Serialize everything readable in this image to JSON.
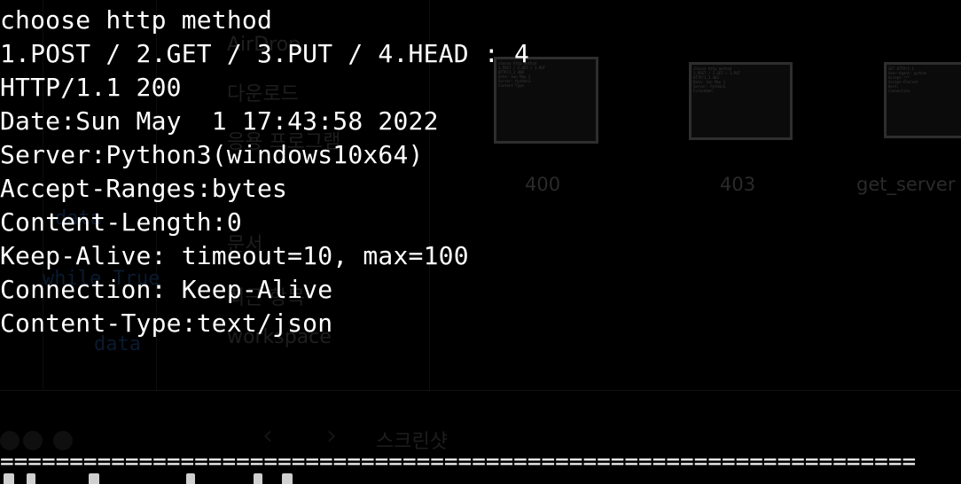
{
  "terminal": {
    "lines": [
      "choose http method",
      "1.POST / 2.GET / 3.PUT / 4.HEAD : 4",
      "HTTP/1.1 200",
      "Date:Sun May  1 17:43:58 2022",
      "Server:Python3(windows10x64)",
      "Accept-Ranges:bytes",
      "Content-Length:0",
      "Keep-Alive: timeout=10, max=100",
      "Connection: Keep-Alive",
      "Content-Type:text/json"
    ],
    "separator": "=================================================================="
  },
  "background": {
    "thumbnails": [
      {
        "label": "400"
      },
      {
        "label": "403"
      },
      {
        "label": "get_server"
      }
    ],
    "ghost_texts": {
      "a": "AirDrop",
      "b": "다운로드",
      "c": "data",
      "d": "while True",
      "e": "workspace",
      "f": "스크린샷",
      "g": "응용 프로그램",
      "h": "문서",
      "i": "최근 항목"
    },
    "colors": {
      "background": "#000000",
      "text": "#ffffff"
    }
  }
}
